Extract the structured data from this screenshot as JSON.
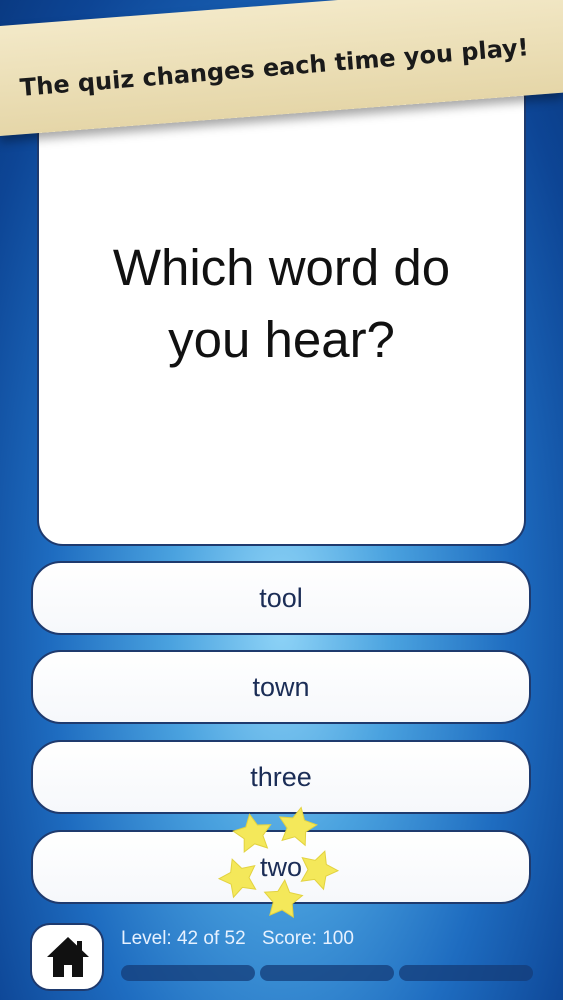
{
  "banner": {
    "text": "The quiz changes each time you play!"
  },
  "tabs": [
    {
      "icon": "minimize-icon"
    },
    {
      "icon": "clock-icon"
    }
  ],
  "question": {
    "text": "Which word do you hear?"
  },
  "answers": [
    {
      "label": "tool"
    },
    {
      "label": "town"
    },
    {
      "label": "three"
    },
    {
      "label": "two"
    }
  ],
  "status": {
    "level": "Level: 42 of 52",
    "score": "Score: 100",
    "progress_segments": 3
  },
  "colors": {
    "accent_border": "#1e3a6e",
    "banner": "#efe3bf",
    "stars": "#f4e85a"
  }
}
